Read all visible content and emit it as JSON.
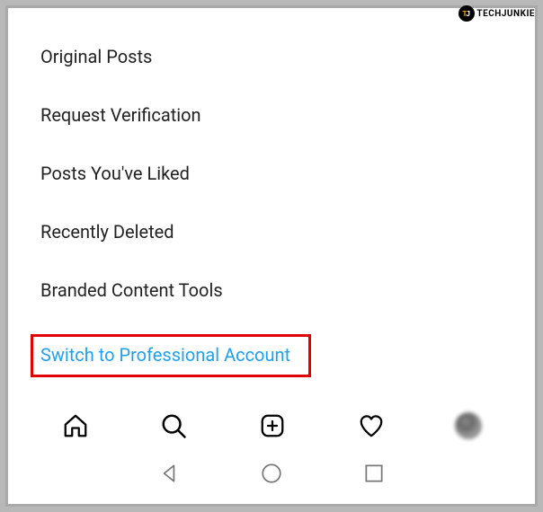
{
  "watermark": {
    "text": "TECHJUNKIE"
  },
  "settings": {
    "items": [
      {
        "label": "Original Posts"
      },
      {
        "label": "Request Verification"
      },
      {
        "label": "Posts You've Liked"
      },
      {
        "label": "Recently Deleted"
      },
      {
        "label": "Branded Content Tools"
      }
    ],
    "highlighted": {
      "label": "Switch to Professional Account"
    }
  },
  "navbar": {
    "home_icon": "home-icon",
    "search_icon": "search-icon",
    "create_icon": "create-icon",
    "activity_icon": "heart-icon",
    "profile_icon": "avatar"
  },
  "system_nav": {
    "back": "back-icon",
    "home": "circle-icon",
    "recent": "square-icon"
  },
  "colors": {
    "link": "#1ea1f1",
    "highlight_border": "#e20000",
    "text": "#222222"
  }
}
